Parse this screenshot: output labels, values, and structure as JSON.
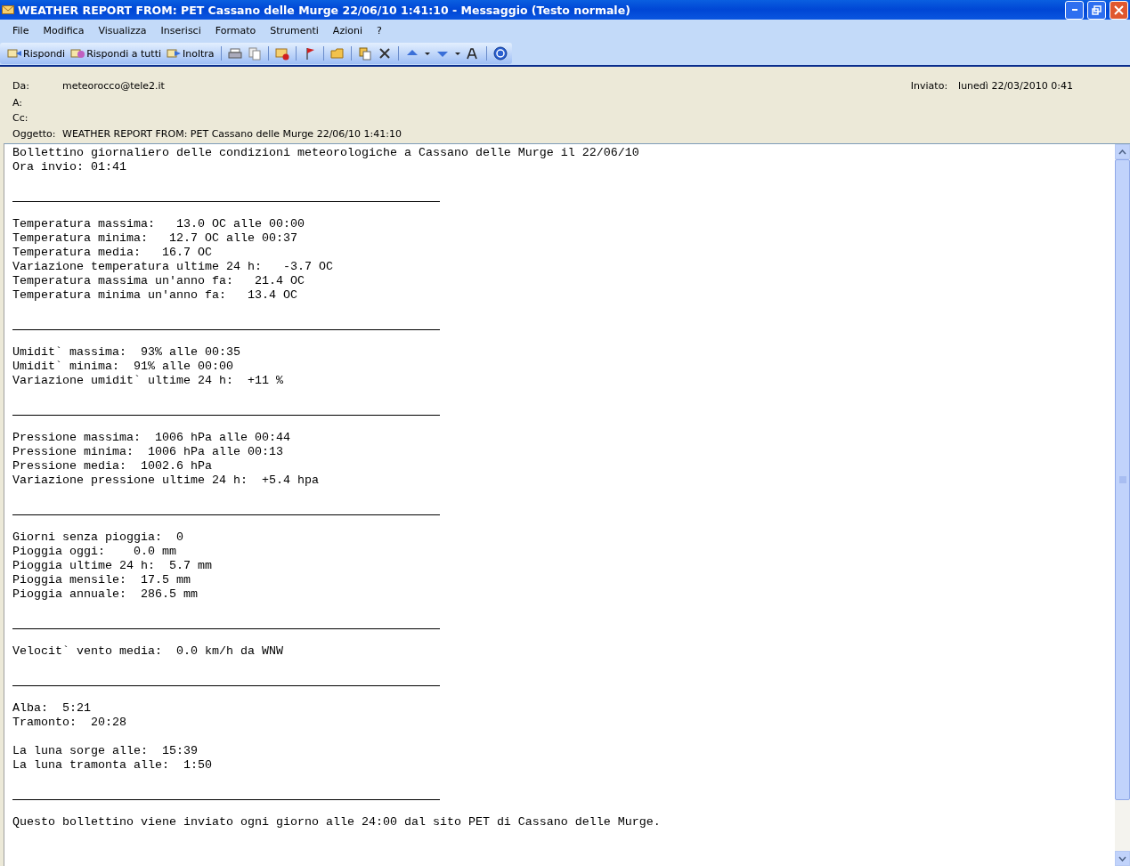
{
  "window": {
    "title": "WEATHER REPORT FROM: PET Cassano delle Murge 22/06/10 1:41:10 - Messaggio (Testo normale)"
  },
  "menu": [
    "File",
    "Modifica",
    "Visualizza",
    "Inserisci",
    "Formato",
    "Strumenti",
    "Azioni",
    "?"
  ],
  "toolbar": [
    {
      "kind": "labeled",
      "label": "Rispondi"
    },
    {
      "kind": "labeled",
      "label": "Rispondi a tutti"
    },
    {
      "kind": "labeled",
      "label": "Inoltra"
    },
    {
      "kind": "separator"
    },
    {
      "kind": "icon"
    },
    {
      "kind": "icon"
    },
    {
      "kind": "separator"
    },
    {
      "kind": "icon"
    },
    {
      "kind": "separator"
    },
    {
      "kind": "icon"
    },
    {
      "kind": "separator"
    },
    {
      "kind": "icon"
    },
    {
      "kind": "separator"
    },
    {
      "kind": "icon"
    },
    {
      "kind": "icon"
    },
    {
      "kind": "separator"
    },
    {
      "kind": "icon"
    },
    {
      "kind": "icon"
    },
    {
      "kind": "icon"
    },
    {
      "kind": "icon"
    },
    {
      "kind": "icon"
    },
    {
      "kind": "separator"
    },
    {
      "kind": "icon"
    }
  ],
  "header": {
    "from_label": "Da:",
    "from": "meteorocco@tele2.it",
    "to_label": "A:",
    "cc_label": "Cc:",
    "subject_label": "Oggetto:",
    "subject": "WEATHER REPORT FROM: PET Cassano delle Murge 22/06/10 1:41:10",
    "sent_label": "Inviato:",
    "sent": "lunedì 22/03/2010 0:41"
  },
  "body": [
    {
      "kind": "line",
      "text": "Bollettino giornaliero delle condizioni meteorologiche a Cassano delle Murge il 22/06/10"
    },
    {
      "kind": "line",
      "text": "Ora invio: 01:41"
    },
    {
      "kind": "blank"
    },
    {
      "kind": "rule"
    },
    {
      "kind": "blank"
    },
    {
      "kind": "line",
      "text": "Temperatura massima:   13.0 OC alle 00:00"
    },
    {
      "kind": "line",
      "text": "Temperatura minima:   12.7 OC alle 00:37"
    },
    {
      "kind": "line",
      "text": "Temperatura media:   16.7 OC"
    },
    {
      "kind": "line",
      "text": "Variazione temperatura ultime 24 h:   -3.7 OC"
    },
    {
      "kind": "line",
      "text": "Temperatura massima un'anno fa:   21.4 OC"
    },
    {
      "kind": "line",
      "text": "Temperatura minima un'anno fa:   13.4 OC"
    },
    {
      "kind": "blank"
    },
    {
      "kind": "rule"
    },
    {
      "kind": "blank"
    },
    {
      "kind": "line",
      "text": "Umidit` massima:  93% alle 00:35"
    },
    {
      "kind": "line",
      "text": "Umidit` minima:  91% alle 00:00"
    },
    {
      "kind": "line",
      "text": "Variazione umidit` ultime 24 h:  +11 %"
    },
    {
      "kind": "blank"
    },
    {
      "kind": "rule"
    },
    {
      "kind": "blank"
    },
    {
      "kind": "line",
      "text": "Pressione massima:  1006 hPa alle 00:44"
    },
    {
      "kind": "line",
      "text": "Pressione minima:  1006 hPa alle 00:13"
    },
    {
      "kind": "line",
      "text": "Pressione media:  1002.6 hPa"
    },
    {
      "kind": "line",
      "text": "Variazione pressione ultime 24 h:  +5.4 hpa"
    },
    {
      "kind": "blank"
    },
    {
      "kind": "rule"
    },
    {
      "kind": "blank"
    },
    {
      "kind": "line",
      "text": "Giorni senza pioggia:  0"
    },
    {
      "kind": "line",
      "text": "Pioggia oggi:    0.0 mm"
    },
    {
      "kind": "line",
      "text": "Pioggia ultime 24 h:  5.7 mm"
    },
    {
      "kind": "line",
      "text": "Pioggia mensile:  17.5 mm"
    },
    {
      "kind": "line",
      "text": "Pioggia annuale:  286.5 mm"
    },
    {
      "kind": "blank"
    },
    {
      "kind": "rule"
    },
    {
      "kind": "blank"
    },
    {
      "kind": "line",
      "text": "Velocit` vento media:  0.0 km/h da WNW"
    },
    {
      "kind": "blank"
    },
    {
      "kind": "rule"
    },
    {
      "kind": "blank"
    },
    {
      "kind": "line",
      "text": "Alba:  5:21"
    },
    {
      "kind": "line",
      "text": "Tramonto:  20:28"
    },
    {
      "kind": "blank"
    },
    {
      "kind": "line",
      "text": "La luna sorge alle:  15:39"
    },
    {
      "kind": "line",
      "text": "La luna tramonta alle:  1:50"
    },
    {
      "kind": "blank"
    },
    {
      "kind": "rule"
    },
    {
      "kind": "blank"
    },
    {
      "kind": "line",
      "text": "Questo bollettino viene inviato ogni giorno alle 24:00 dal sito PET di Cassano delle Murge."
    }
  ]
}
